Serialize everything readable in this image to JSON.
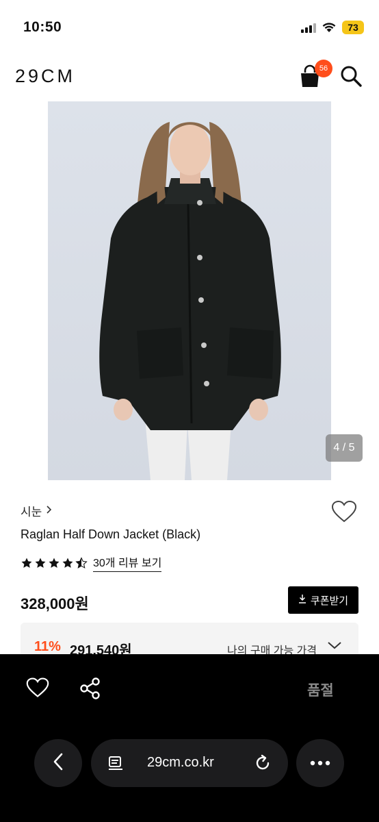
{
  "status": {
    "time": "10:50",
    "battery": "73"
  },
  "header": {
    "logo": "29CM",
    "cart_count": "56"
  },
  "image": {
    "counter": "4 / 5"
  },
  "product": {
    "brand": "시눈",
    "name": "Raglan Half Down Jacket (Black)",
    "rating": 4.5,
    "review_link": "30개 리뷰 보기",
    "price": "328,000원",
    "coupon_label": "쿠폰받기",
    "discount_rate": "11%",
    "discount_price": "291,540원",
    "discount_label": "나의 구매 가능 가격"
  },
  "bottom": {
    "soldout": "품절"
  },
  "browser": {
    "url": "29cm.co.kr"
  },
  "colors": {
    "accent": "#ff4e1b",
    "battery": "#f5c518"
  }
}
